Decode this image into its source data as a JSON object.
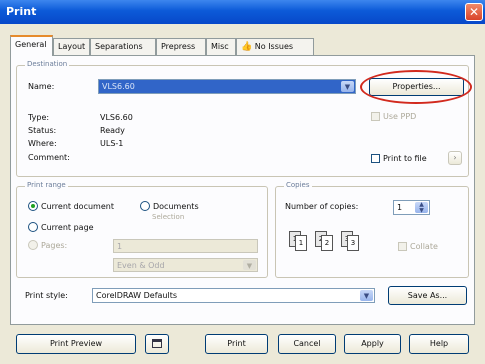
{
  "window": {
    "title": "Print",
    "close_glyph": "✕"
  },
  "tabs": [
    {
      "label": "General"
    },
    {
      "label": "Layout"
    },
    {
      "label": "Separations"
    },
    {
      "label": "Prepress"
    },
    {
      "label": "Misc"
    },
    {
      "label": "No Issues"
    }
  ],
  "destination": {
    "legend": "Destination",
    "name_label": "Name:",
    "name_value": "VLS6.60",
    "properties_label": "Properties...",
    "type_label": "Type:",
    "type_value": "VLS6.60",
    "status_label": "Status:",
    "status_value": "Ready",
    "where_label": "Where:",
    "where_value": "ULS-1",
    "comment_label": "Comment:",
    "use_ppd_label": "Use PPD",
    "print_to_file_label": "Print to file",
    "file_arrow": "›"
  },
  "print_range": {
    "legend": "Print range",
    "current_document": "Current document",
    "documents": "Documents",
    "current_page": "Current page",
    "selection": "Selection",
    "pages_label": "Pages:",
    "pages_value": "1",
    "even_odd": "Even & Odd"
  },
  "copies": {
    "legend": "Copies",
    "number_label": "Number of copies:",
    "number_value": "1",
    "collate_label": "Collate",
    "icon_pages": [
      "1",
      "1",
      "2",
      "2",
      "3",
      "3"
    ]
  },
  "print_style": {
    "label": "Print style:",
    "value": "CorelDRAW Defaults",
    "save_as": "Save As..."
  },
  "footer": {
    "preview": "Print Preview",
    "print": "Print",
    "cancel": "Cancel",
    "apply": "Apply",
    "help": "Help"
  },
  "colors": {
    "accent": "#0c5ad8",
    "highlight_oval": "#d22a1e",
    "selection": "#3165c8"
  }
}
